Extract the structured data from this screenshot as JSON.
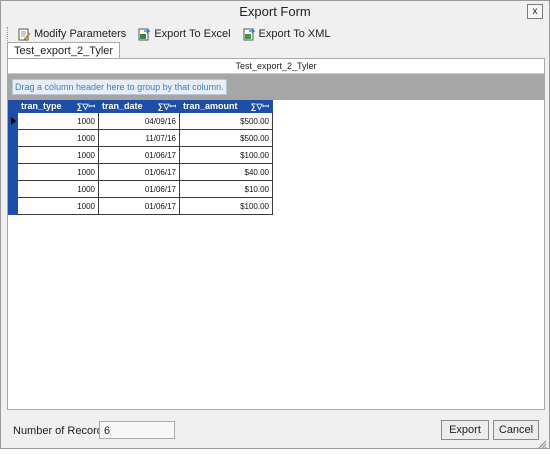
{
  "window": {
    "title": "Export Form",
    "close_label": "x"
  },
  "toolbar": {
    "modify_label": "Modify Parameters",
    "excel_label": "Export To Excel",
    "xml_label": "Export To XML"
  },
  "tab": {
    "label": "Test_export_2_Tyler"
  },
  "grid": {
    "caption": "Test_export_2_Tyler",
    "group_hint": "Drag a column header here to group by that column.",
    "header_icons": "∑▽ꟷ",
    "columns": [
      "tran_type",
      "tran_date",
      "tran_amount"
    ],
    "rows": [
      [
        "1000",
        "04/09/16",
        "$500.00"
      ],
      [
        "1000",
        "11/07/16",
        "$500.00"
      ],
      [
        "1000",
        "01/06/17",
        "$100.00"
      ],
      [
        "1000",
        "01/06/17",
        "$40.00"
      ],
      [
        "1000",
        "01/06/17",
        "$10.00"
      ],
      [
        "1000",
        "01/06/17",
        "$100.00"
      ]
    ]
  },
  "footer": {
    "records_label": "Number of Records",
    "records_value": "6",
    "export_label": "Export",
    "cancel_label": "Cancel"
  }
}
